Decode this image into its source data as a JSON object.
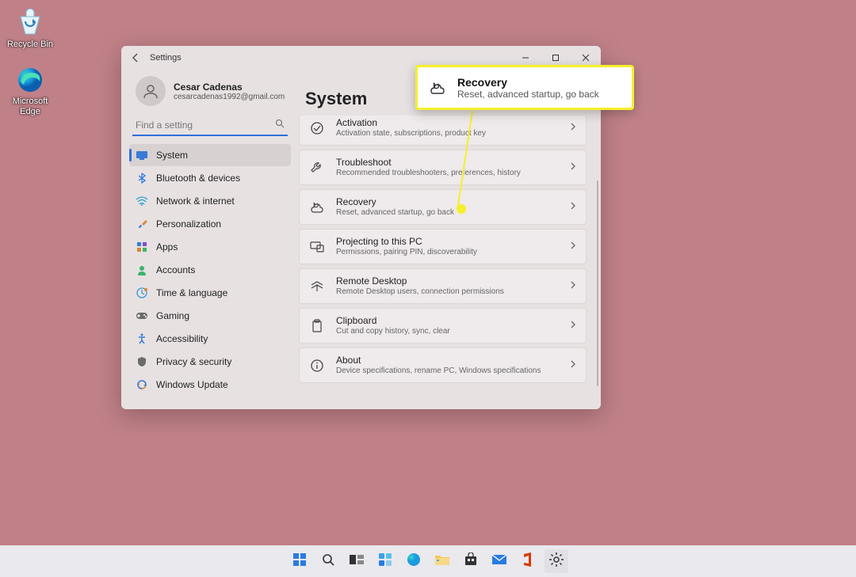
{
  "desktop": {
    "recycle_bin": "Recycle Bin",
    "edge": "Microsoft Edge"
  },
  "window": {
    "title": "Settings",
    "profile": {
      "name": "Cesar Cadenas",
      "email": "cesarcadenas1992@gmail.com"
    },
    "search_placeholder": "Find a setting",
    "nav": [
      {
        "label": "System",
        "icon": "system"
      },
      {
        "label": "Bluetooth & devices",
        "icon": "bluetooth"
      },
      {
        "label": "Network & internet",
        "icon": "wifi"
      },
      {
        "label": "Personalization",
        "icon": "brush"
      },
      {
        "label": "Apps",
        "icon": "apps"
      },
      {
        "label": "Accounts",
        "icon": "account"
      },
      {
        "label": "Time & language",
        "icon": "time"
      },
      {
        "label": "Gaming",
        "icon": "gaming"
      },
      {
        "label": "Accessibility",
        "icon": "access"
      },
      {
        "label": "Privacy & security",
        "icon": "privacy"
      },
      {
        "label": "Windows Update",
        "icon": "update"
      }
    ],
    "page_title": "System",
    "items": [
      {
        "title": "Activation",
        "sub": "Activation state, subscriptions, product key",
        "icon": "check"
      },
      {
        "title": "Troubleshoot",
        "sub": "Recommended troubleshooters, preferences, history",
        "icon": "wrench"
      },
      {
        "title": "Recovery",
        "sub": "Reset, advanced startup, go back",
        "icon": "recovery"
      },
      {
        "title": "Projecting to this PC",
        "sub": "Permissions, pairing PIN, discoverability",
        "icon": "project"
      },
      {
        "title": "Remote Desktop",
        "sub": "Remote Desktop users, connection permissions",
        "icon": "remote"
      },
      {
        "title": "Clipboard",
        "sub": "Cut and copy history, sync, clear",
        "icon": "clipboard"
      },
      {
        "title": "About",
        "sub": "Device specifications, rename PC, Windows specifications",
        "icon": "about"
      }
    ]
  },
  "callout": {
    "title": "Recovery",
    "sub": "Reset, advanced startup, go back"
  },
  "taskbar": [
    "start",
    "search",
    "taskview",
    "widgets",
    "edge",
    "explorer",
    "store",
    "mail",
    "office",
    "settings"
  ]
}
